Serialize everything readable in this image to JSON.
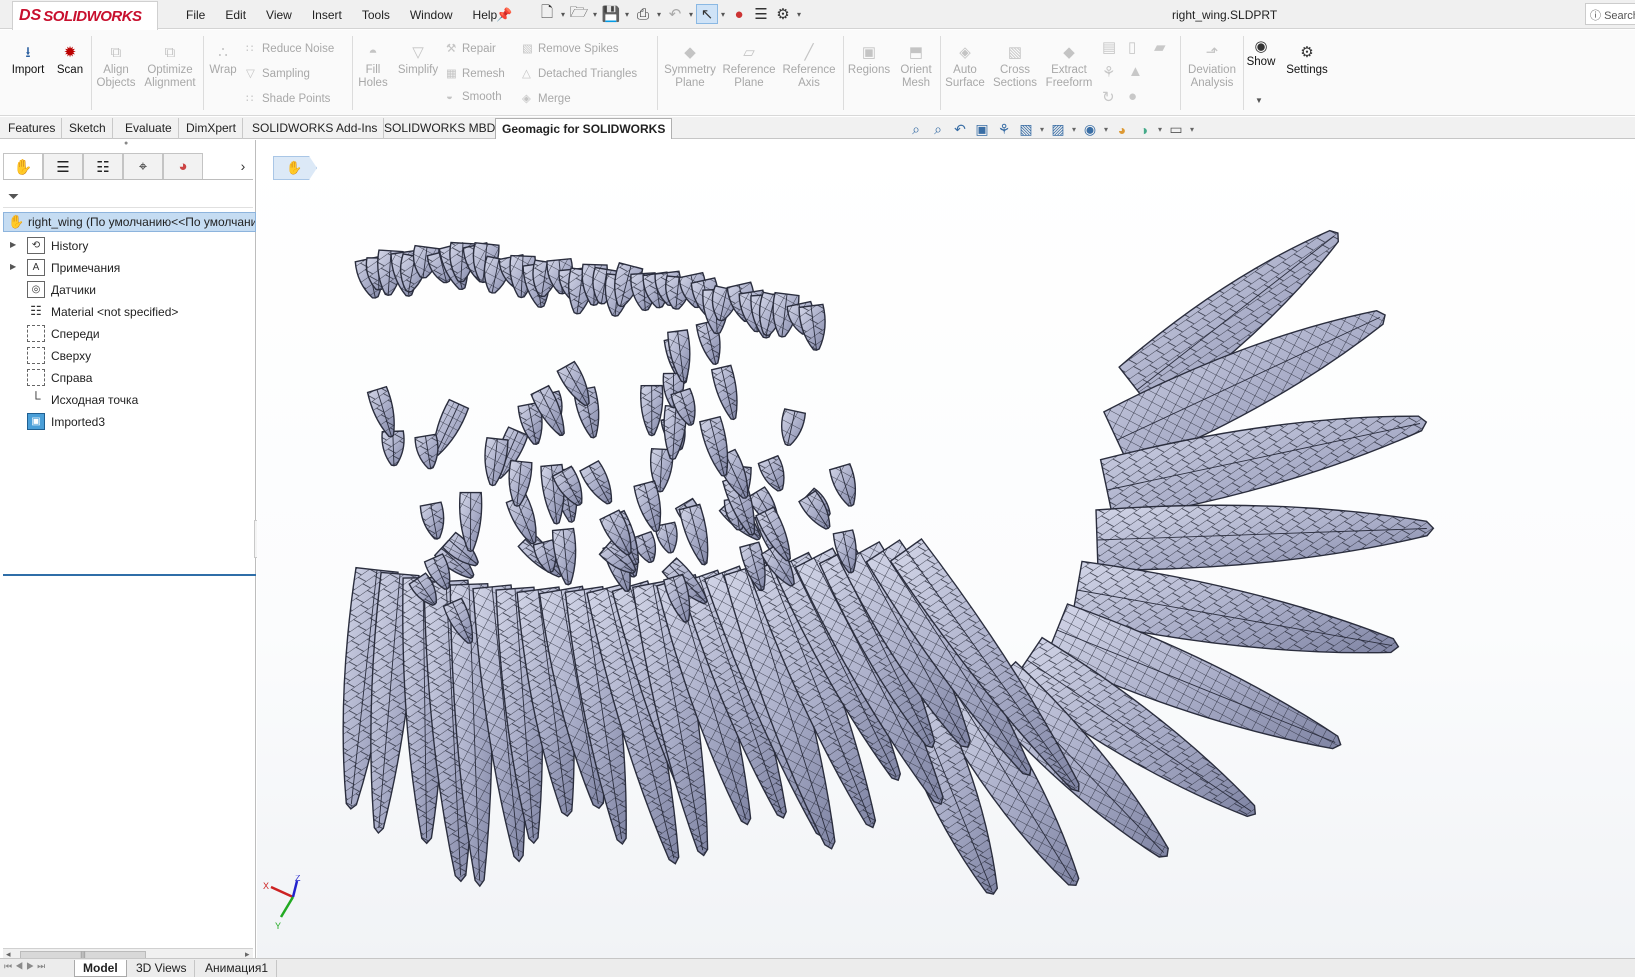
{
  "app": {
    "logo_ds": "DS",
    "logo_text": "SOLIDWORKS",
    "doc_title": "right_wing.SLDPRT",
    "help_search": "Search"
  },
  "menu": [
    "File",
    "Edit",
    "View",
    "Insert",
    "Tools",
    "Window",
    "Help"
  ],
  "ribbon": {
    "import": "Import",
    "scan": "Scan",
    "align_objects": [
      "Align",
      "Objects"
    ],
    "optimize_alignment": [
      "Optimize",
      "Alignment"
    ],
    "wrap": "Wrap",
    "reduce_noise": "Reduce Noise",
    "sampling": "Sampling",
    "shade_points": "Shade Points",
    "fill_holes": [
      "Fill",
      "Holes"
    ],
    "simplify": "Simplify",
    "repair": "Repair",
    "remesh": "Remesh",
    "smooth": "Smooth",
    "remove_spikes": "Remove Spikes",
    "detached_triangles": "Detached Triangles",
    "merge": "Merge",
    "symmetry_plane": [
      "Symmetry",
      "Plane"
    ],
    "reference_plane": [
      "Reference",
      "Plane"
    ],
    "reference_axis": [
      "Reference",
      "Axis"
    ],
    "regions": "Regions",
    "orient_mesh": [
      "Orient",
      "Mesh"
    ],
    "auto_surface": [
      "Auto",
      "Surface"
    ],
    "cross_sections": [
      "Cross",
      "Sections"
    ],
    "extract_freeform": [
      "Extract",
      "Freeform"
    ],
    "deviation_analysis": [
      "Deviation",
      "Analysis"
    ],
    "show": "Show",
    "settings": "Settings"
  },
  "tabs": [
    "Features",
    "Sketch",
    "Evaluate",
    "DimXpert",
    "SOLIDWORKS Add-Ins",
    "SOLIDWORKS MBD",
    "Geomagic for SOLIDWORKS"
  ],
  "active_tab": "Geomagic for SOLIDWORKS",
  "tree": {
    "root": "right_wing  (По умолчанию<<По умолчанию>)",
    "items": [
      {
        "label": "History",
        "icon": "history-icon",
        "expandable": true
      },
      {
        "label": "Примечания",
        "icon": "annotations-icon",
        "expandable": true
      },
      {
        "label": "Датчики",
        "icon": "sensors-icon",
        "expandable": false
      },
      {
        "label": "Material <not specified>",
        "icon": "material-icon",
        "expandable": false
      },
      {
        "label": "Спереди",
        "icon": "plane-icon",
        "expandable": false
      },
      {
        "label": "Сверху",
        "icon": "plane-icon",
        "expandable": false
      },
      {
        "label": "Справа",
        "icon": "plane-icon",
        "expandable": false
      },
      {
        "label": "Исходная точка",
        "icon": "origin-icon",
        "expandable": false
      },
      {
        "label": "Imported3",
        "icon": "imported-body-icon",
        "expandable": false
      }
    ]
  },
  "bottom_tabs": [
    "Model",
    "3D Views",
    "Анимация1"
  ],
  "active_bottom_tab": "Model",
  "triad": {
    "x": "X",
    "y": "Y",
    "z": "Z"
  },
  "colors": {
    "accent_red": "#c8102e",
    "mesh_fill": "#a9adc8",
    "selection": "#c5dcf2"
  }
}
